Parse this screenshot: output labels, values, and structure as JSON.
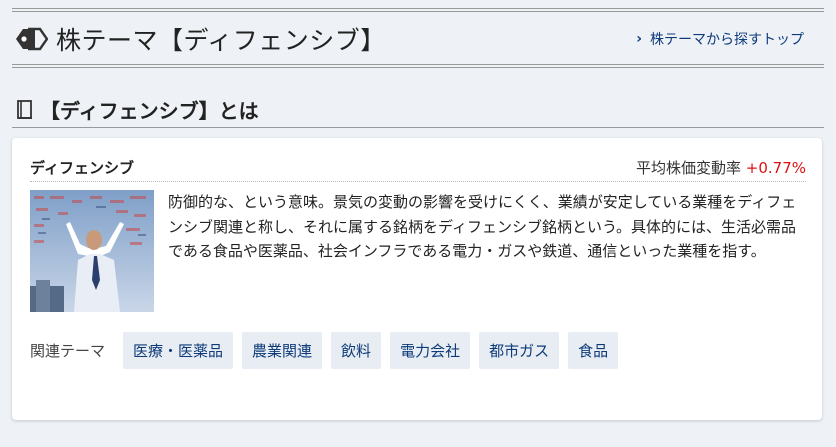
{
  "header": {
    "title": "株テーマ【ディフェンシブ】",
    "link_label": "株テーマから探すトップ"
  },
  "section": {
    "title": "【ディフェンシブ】とは"
  },
  "card": {
    "theme_name": "ディフェンシブ",
    "avg_label": "平均株価変動率",
    "avg_value": "+0.77%",
    "description": "防御的な、という意味。景気の変動の影響を受けにくく、業績が安定している業種をディフェンシブ関連と称し、それに属する銘柄をディフェンシブ銘柄という。具体的には、生活必需品である食品や医薬品、社会インフラである電力・ガスや鉄道、通信といった業種を指す。",
    "related_label": "関連テーマ",
    "related_themes": [
      "医療・医薬品",
      "農業関連",
      "飲料",
      "電力会社",
      "都市ガス",
      "食品"
    ]
  },
  "colors": {
    "link": "#0d3b7a",
    "positive": "#d11111",
    "chip_bg": "#e8edf3",
    "page_bg": "#eef2f7"
  },
  "icons": {
    "title": "tag-icon",
    "link": "chevron-right-icon",
    "section": "book-icon"
  }
}
